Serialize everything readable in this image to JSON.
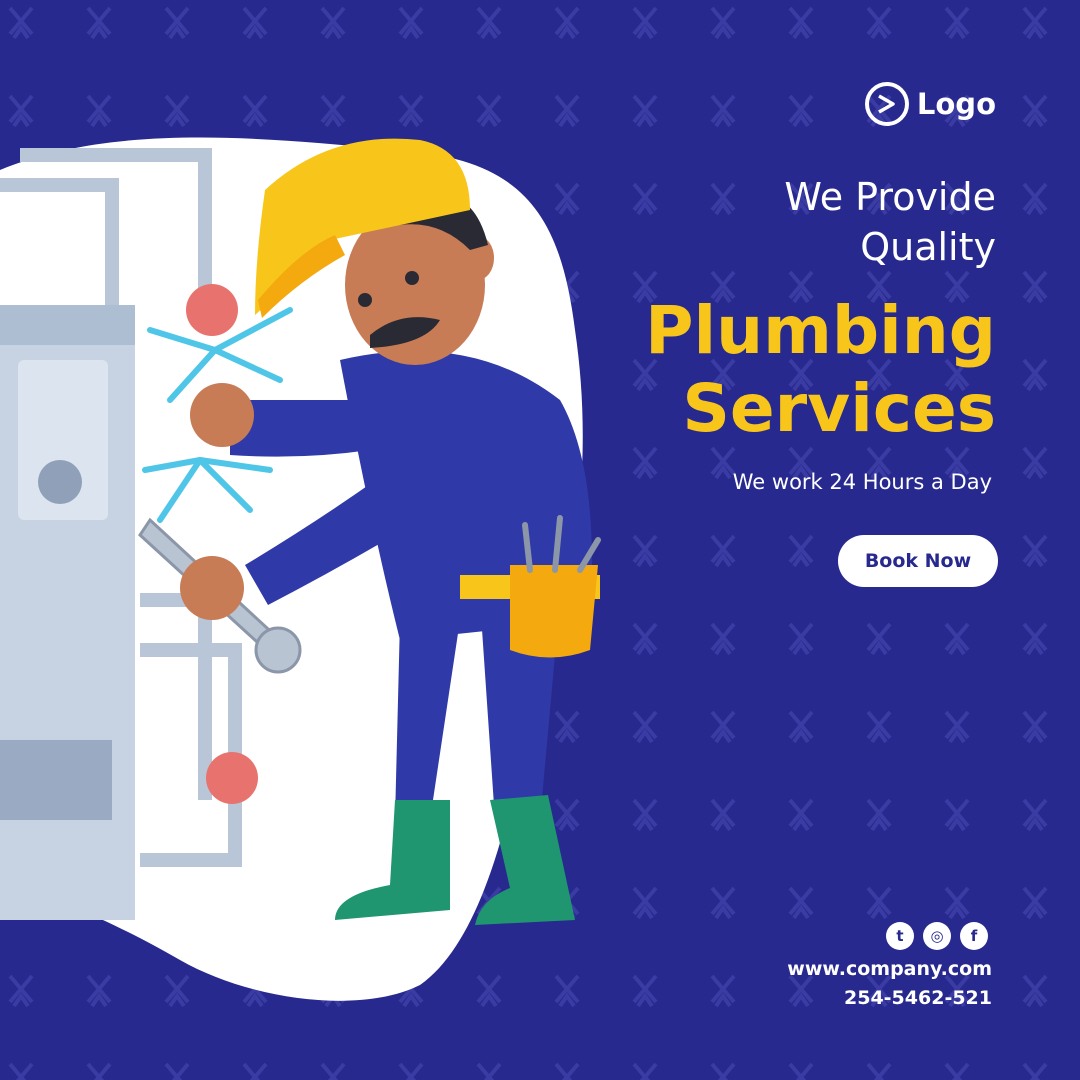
{
  "brand": {
    "logo_text": "Logo",
    "logo_icon": "play-circle-icon"
  },
  "headline": {
    "line1": "We Provide",
    "line2": "Quality"
  },
  "service": {
    "line1": "Plumbing",
    "line2": "Services"
  },
  "tagline": "We work 24 Hours a Day",
  "cta": {
    "label": "Book Now"
  },
  "social": [
    {
      "icon": "twitter-icon",
      "glyph": "t"
    },
    {
      "icon": "instagram-icon",
      "glyph": "◎"
    },
    {
      "icon": "facebook-icon",
      "glyph": "f"
    }
  ],
  "contact": {
    "website": "www.company.com",
    "phone": "254-5462-521"
  },
  "colors": {
    "background": "#27298f",
    "accent_yellow": "#f8c61b",
    "white": "#ffffff",
    "boot_green": "#1f9670",
    "pipe_grey": "#b8c6d8"
  }
}
